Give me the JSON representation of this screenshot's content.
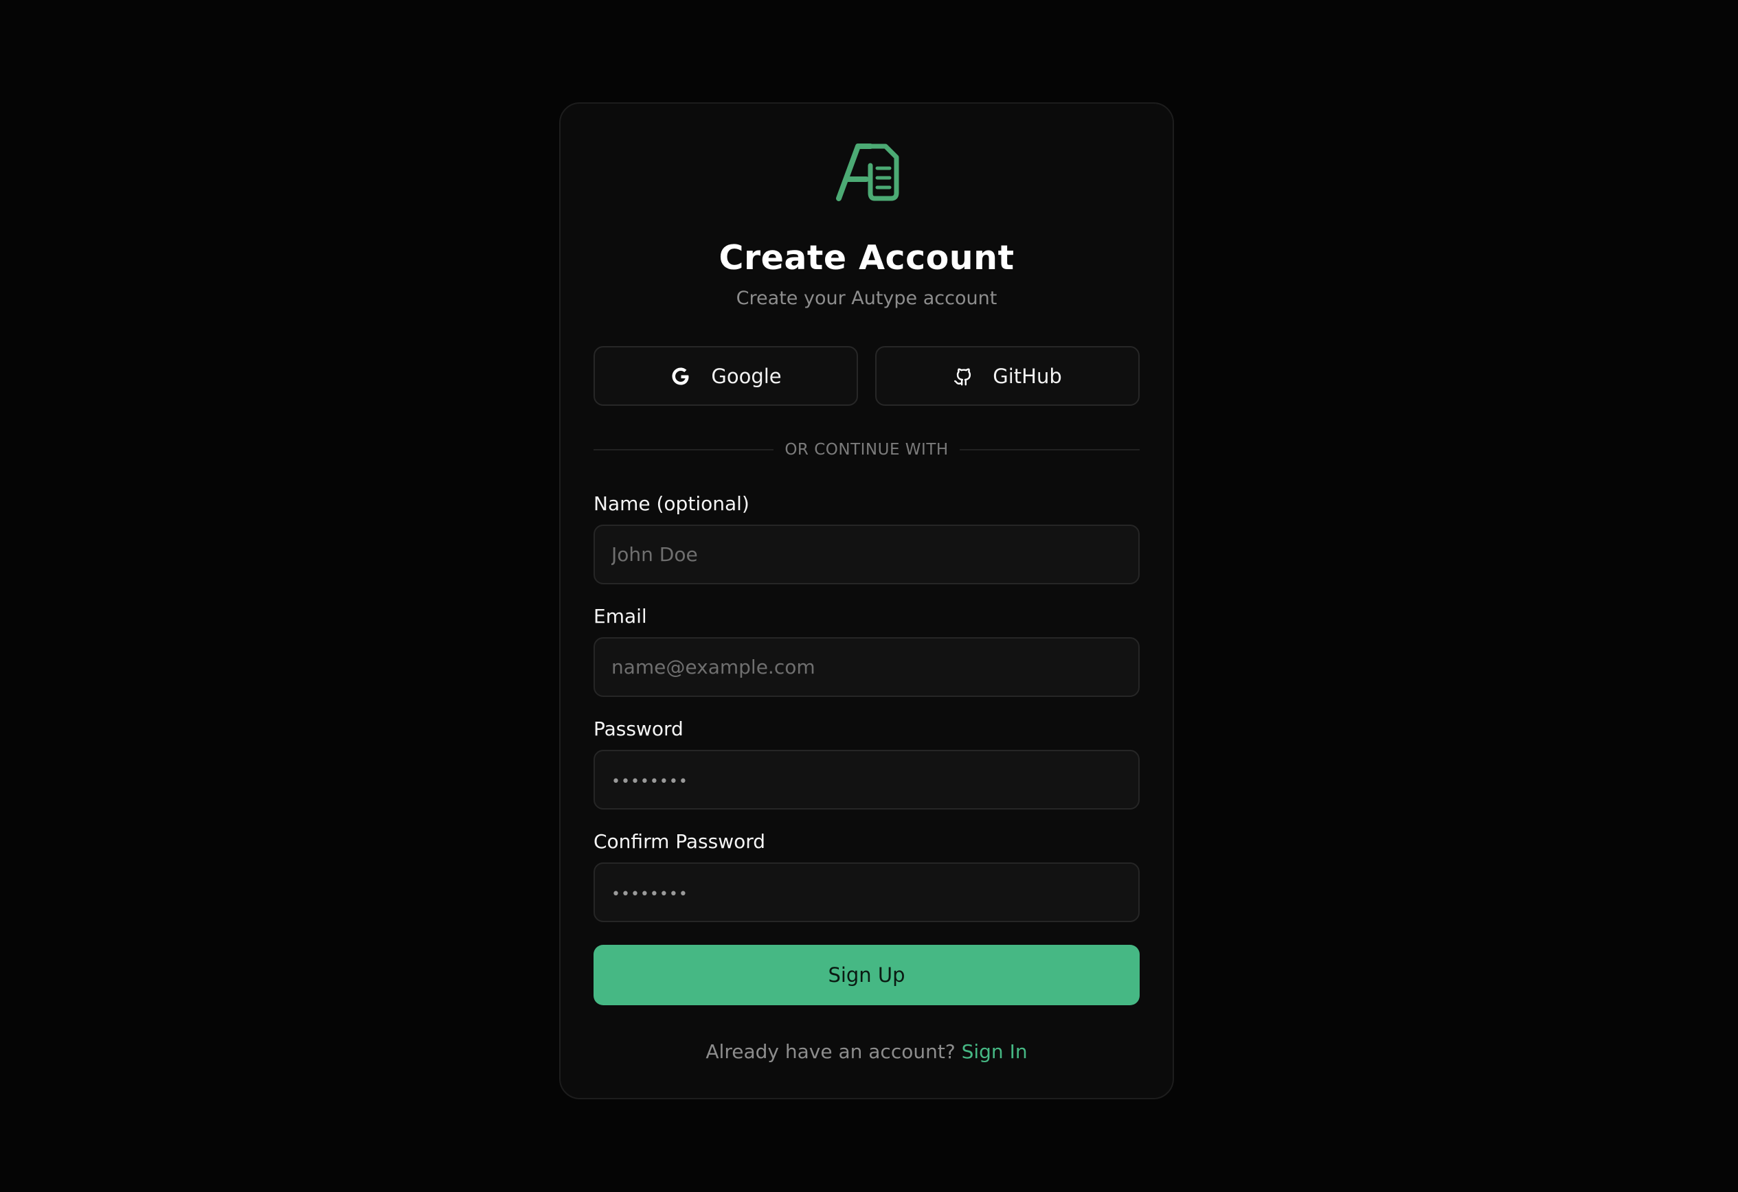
{
  "brand": {
    "logo_icon": "autype-logo-icon",
    "accent_color": "#46b884"
  },
  "header": {
    "title": "Create Account",
    "subtitle": "Create your Autype account"
  },
  "oauth": {
    "google_label": "Google",
    "google_icon": "google-icon",
    "github_label": "GitHub",
    "github_icon": "github-icon"
  },
  "divider": {
    "text": "OR CONTINUE WITH"
  },
  "form": {
    "name": {
      "label": "Name (optional)",
      "placeholder": "John Doe",
      "value": ""
    },
    "email": {
      "label": "Email",
      "placeholder": "name@example.com",
      "value": ""
    },
    "password": {
      "label": "Password",
      "placeholder": "••••••••",
      "value": ""
    },
    "confirm_password": {
      "label": "Confirm Password",
      "placeholder": "••••••••",
      "value": ""
    },
    "submit_label": "Sign Up"
  },
  "footer": {
    "prompt": "Already have an account?",
    "link_label": "Sign In"
  }
}
